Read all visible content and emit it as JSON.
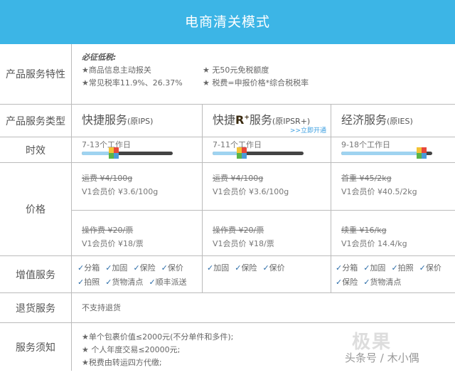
{
  "title": "电商清关模式",
  "features": {
    "label": "产品服务特性",
    "heading": "必征低税:",
    "items": [
      "★商品信息主动报关",
      "★ 无50元免税额度",
      "★常见税率11.9%、26.37%",
      "★ 税费=申报价格*综合税税率"
    ]
  },
  "types": {
    "label": "产品服务类型",
    "cols": [
      {
        "name": "快捷服务",
        "orig": "(原IPS)"
      },
      {
        "name_a": "快捷",
        "name_r": "R",
        "name_plus": "+",
        "name_b": "服务",
        "orig": "(原IPSR+)",
        "link": ">>立即开通"
      },
      {
        "name": "经济服务",
        "orig": "(原IES)"
      }
    ]
  },
  "timing": {
    "label": "时效",
    "cols": [
      {
        "text": "7-13个工作日",
        "progress": 0.35
      },
      {
        "text": "7-11个工作日",
        "progress": 0.32
      },
      {
        "text": "9-18个工作日",
        "progress": 0.88
      }
    ]
  },
  "price": {
    "label": "价格",
    "top": [
      {
        "old": "运费 ¥4/100g",
        "new": "V1会员价 ¥3.6/100g"
      },
      {
        "old": "运费 ¥4/100g",
        "new": "V1会员价 ¥3.6/100g"
      },
      {
        "old": "首重 ¥45/2kg",
        "new": "V1会员价 ¥40.5/2kg"
      }
    ],
    "bottom": [
      {
        "old": "操作费 ¥20/票",
        "new": "V1会员价 ¥18/票"
      },
      {
        "old": "操作费 ¥20/票",
        "new": "V1会员价 ¥18/票"
      },
      {
        "old": "续重 ¥16/kg",
        "new": "V1会员价 14.4/kg"
      }
    ]
  },
  "value_added": {
    "label": "增值服务",
    "cols": [
      [
        "分箱",
        "加固",
        "保险",
        "保价",
        "拍照",
        "货物清点",
        "顺丰派送"
      ],
      [
        "加固",
        "保险",
        "保价"
      ],
      [
        "分箱",
        "加固",
        "拍照",
        "保价",
        "保险",
        "货物清点"
      ]
    ]
  },
  "returns": {
    "label": "退货服务",
    "text": "不支持退货"
  },
  "notes": {
    "label": "服务须知",
    "items": [
      "★单个包裹价值≤2000元(不分单件和多件);",
      "★ 个人年度交易≤20000元;",
      "★税费由转运四方代缴;"
    ]
  },
  "watermark": {
    "logo": "极果",
    "text": "头条号 / 木小偶"
  }
}
